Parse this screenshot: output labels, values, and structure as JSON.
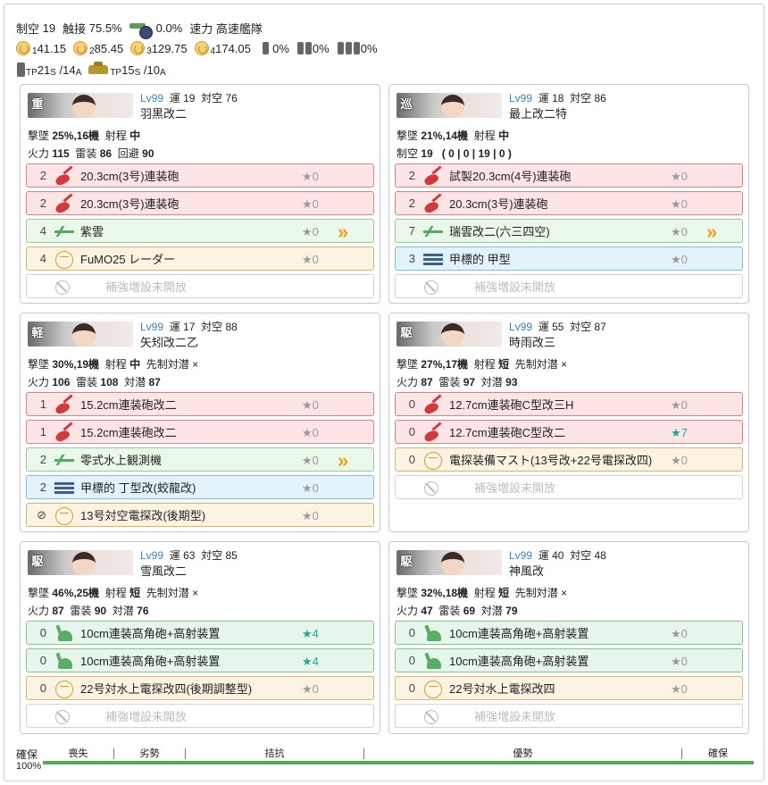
{
  "summary": {
    "air_label": "制空",
    "air": "19",
    "contact_label": "触接",
    "contact": "75.5%",
    "plane_pct": "0.0%",
    "speed_label": "速力",
    "speed": "高速艦隊",
    "los": [
      {
        "sub": "1",
        "value": "41.15"
      },
      {
        "sub": "2",
        "value": "85.45"
      },
      {
        "sub": "3",
        "value": "129.75"
      },
      {
        "sub": "4",
        "value": "174.05"
      }
    ],
    "drum_pcts": [
      "0%",
      "0%",
      "0%"
    ],
    "tp1": {
      "pre": "TP",
      "s_val": "21",
      "s_sub": "S",
      "sep": "/ ",
      "a_val": "14",
      "a_sub": "A"
    },
    "tp2": {
      "pre": "TP",
      "s_val": "15",
      "s_sub": "S",
      "sep": "/ ",
      "a_val": "10",
      "a_sub": "A"
    }
  },
  "ships": [
    {
      "type_kana": "重",
      "lv": "Lv99",
      "luck_label": "運",
      "luck": "19",
      "aa_label": "対空",
      "aa": "76",
      "name": "羽黒改二",
      "row1": {
        "shoot_label": "撃墜",
        "shoot": "25%,16機",
        "range_label": "射程",
        "range": "中",
        "asw_note": ""
      },
      "row2": {
        "fp_label": "火力",
        "fp": "115",
        "tp_label": "雷装",
        "tp": "86",
        "ev_label": "回避",
        "ev": "90"
      },
      "slots": [
        {
          "kind": "red",
          "icon": "main-gun-icon",
          "count": "2",
          "name": "20.3cm(3号)連装砲",
          "star": "★0",
          "prof": ""
        },
        {
          "kind": "red",
          "icon": "main-gun-icon",
          "count": "2",
          "name": "20.3cm(3号)連装砲",
          "star": "★0",
          "prof": ""
        },
        {
          "kind": "green",
          "icon": "seaplane-icon",
          "count": "4",
          "name": "紫雲",
          "star": "★0",
          "prof": "»"
        },
        {
          "kind": "orange",
          "icon": "radar-icon",
          "count": "4",
          "name": "FuMO25 レーダー",
          "star": "★0",
          "prof": ""
        },
        {
          "kind": "empty",
          "icon": "locked-slot-icon",
          "count": "",
          "name": "補強増設未開放",
          "star": "",
          "prof": ""
        }
      ]
    },
    {
      "type_kana": "巡",
      "lv": "Lv99",
      "luck_label": "運",
      "luck": "18",
      "aa_label": "対空",
      "aa": "86",
      "name": "最上改二特",
      "row1": {
        "shoot_label": "撃墜",
        "shoot": "21%,14機",
        "range_label": "射程",
        "range": "中",
        "asw_note": ""
      },
      "row2": {
        "fp_label": "制空",
        "fp": "19",
        "tp_label": "",
        "tp": "( 0 | 0 | 19 | 0 )",
        "ev_label": "",
        "ev": ""
      },
      "slots": [
        {
          "kind": "red",
          "icon": "main-gun-icon",
          "count": "2",
          "name": "試製20.3cm(4号)連装砲",
          "star": "★0",
          "prof": ""
        },
        {
          "kind": "red",
          "icon": "main-gun-icon",
          "count": "2",
          "name": "20.3cm(3号)連装砲",
          "star": "★0",
          "prof": ""
        },
        {
          "kind": "green",
          "icon": "seaplane-icon",
          "count": "7",
          "name": "瑞雲改二(六三四空)",
          "star": "★0",
          "prof": "»"
        },
        {
          "kind": "blue",
          "icon": "sonar-icon",
          "count": "3",
          "name": "甲標的 甲型",
          "star": "★0",
          "prof": ""
        },
        {
          "kind": "empty",
          "icon": "locked-slot-icon",
          "count": "",
          "name": "補強増設未開放",
          "star": "",
          "prof": ""
        }
      ]
    },
    {
      "type_kana": "軽",
      "lv": "Lv99",
      "luck_label": "運",
      "luck": "17",
      "aa_label": "対空",
      "aa": "88",
      "name": "矢矧改二乙",
      "row1": {
        "shoot_label": "撃墜",
        "shoot": "30%,19機",
        "range_label": "射程",
        "range": "中",
        "asw_note": "先制対潜 ×"
      },
      "row2": {
        "fp_label": "火力",
        "fp": "106",
        "tp_label": "雷装",
        "tp": "108",
        "ev_label": "対潜",
        "ev": "87"
      },
      "slots": [
        {
          "kind": "red",
          "icon": "main-gun-icon",
          "count": "1",
          "name": "15.2cm連装砲改二",
          "star": "★0",
          "prof": ""
        },
        {
          "kind": "red",
          "icon": "main-gun-icon",
          "count": "1",
          "name": "15.2cm連装砲改二",
          "star": "★0",
          "prof": ""
        },
        {
          "kind": "green",
          "icon": "seaplane-icon",
          "count": "2",
          "name": "零式水上観測機",
          "star": "★0",
          "prof": "»"
        },
        {
          "kind": "blue",
          "icon": "sonar-icon",
          "count": "2",
          "name": "甲標的 丁型改(蛟龍改)",
          "star": "★0",
          "prof": ""
        },
        {
          "kind": "orange",
          "icon": "radar-icon",
          "count": "⊘",
          "name": "13号対空電探改(後期型)",
          "star": "★0",
          "prof": ""
        }
      ]
    },
    {
      "type_kana": "駆",
      "lv": "Lv99",
      "luck_label": "運",
      "luck": "55",
      "aa_label": "対空",
      "aa": "87",
      "name": "時雨改三",
      "row1": {
        "shoot_label": "撃墜",
        "shoot": "27%,17機",
        "range_label": "射程",
        "range": "短",
        "asw_note": "先制対潜 ×"
      },
      "row2": {
        "fp_label": "火力",
        "fp": "87",
        "tp_label": "雷装",
        "tp": "97",
        "ev_label": "対潜",
        "ev": "93"
      },
      "slots": [
        {
          "kind": "red",
          "icon": "main-gun-icon",
          "count": "0",
          "name": "12.7cm連装砲C型改三H",
          "star": "★0",
          "prof": ""
        },
        {
          "kind": "red",
          "icon": "main-gun-icon",
          "count": "0",
          "name": "12.7cm連装砲C型改二",
          "star": "★7",
          "prof": ""
        },
        {
          "kind": "orange",
          "icon": "radar-icon",
          "count": "0",
          "name": "電探装備マスト(13号改+22号電探改四)",
          "star": "★0",
          "prof": ""
        },
        {
          "kind": "empty",
          "icon": "locked-slot-icon",
          "count": "",
          "name": "補強増設未開放",
          "star": "",
          "prof": ""
        }
      ]
    },
    {
      "type_kana": "駆",
      "lv": "Lv99",
      "luck_label": "運",
      "luck": "63",
      "aa_label": "対空",
      "aa": "85",
      "name": "雪風改二",
      "row1": {
        "shoot_label": "撃墜",
        "shoot": "46%,25機",
        "range_label": "射程",
        "range": "短",
        "asw_note": "先制対潜 ×"
      },
      "row2": {
        "fp_label": "火力",
        "fp": "87",
        "tp_label": "雷装",
        "tp": "90",
        "ev_label": "対潜",
        "ev": "76"
      },
      "slots": [
        {
          "kind": "aa",
          "icon": "high-angle-gun-icon",
          "count": "0",
          "name": "10cm連装高角砲+高射装置",
          "star": "★4",
          "prof": ""
        },
        {
          "kind": "aa",
          "icon": "high-angle-gun-icon",
          "count": "0",
          "name": "10cm連装高角砲+高射装置",
          "star": "★4",
          "prof": ""
        },
        {
          "kind": "orange",
          "icon": "radar-icon",
          "count": "0",
          "name": "22号対水上電探改四(後期調整型)",
          "star": "★0",
          "prof": ""
        },
        {
          "kind": "empty",
          "icon": "locked-slot-icon",
          "count": "",
          "name": "補強増設未開放",
          "star": "",
          "prof": ""
        }
      ]
    },
    {
      "type_kana": "駆",
      "lv": "Lv99",
      "luck_label": "運",
      "luck": "40",
      "aa_label": "対空",
      "aa": "48",
      "name": "神風改",
      "row1": {
        "shoot_label": "撃墜",
        "shoot": "32%,18機",
        "range_label": "射程",
        "range": "短",
        "asw_note": "先制対潜 ×"
      },
      "row2": {
        "fp_label": "火力",
        "fp": "47",
        "tp_label": "雷装",
        "tp": "69",
        "ev_label": "対潜",
        "ev": "79"
      },
      "slots": [
        {
          "kind": "aa",
          "icon": "high-angle-gun-icon",
          "count": "0",
          "name": "10cm連装高角砲+高射装置",
          "star": "★0",
          "prof": ""
        },
        {
          "kind": "aa",
          "icon": "high-angle-gun-icon",
          "count": "0",
          "name": "10cm連装高角砲+高射装置",
          "star": "★0",
          "prof": ""
        },
        {
          "kind": "orange",
          "icon": "radar-icon",
          "count": "0",
          "name": "22号対水上電探改四",
          "star": "★0",
          "prof": ""
        },
        {
          "kind": "empty",
          "icon": "locked-slot-icon",
          "count": "",
          "name": "補強増設未開放",
          "star": "",
          "prof": ""
        }
      ]
    }
  ],
  "air_state": {
    "left_label": "確保",
    "pct": "100%",
    "fill_fraction": 1.0,
    "segments": [
      "喪失",
      "劣勢",
      "拮抗",
      "優勢",
      "確保"
    ],
    "bar_color": "#4caf50"
  }
}
